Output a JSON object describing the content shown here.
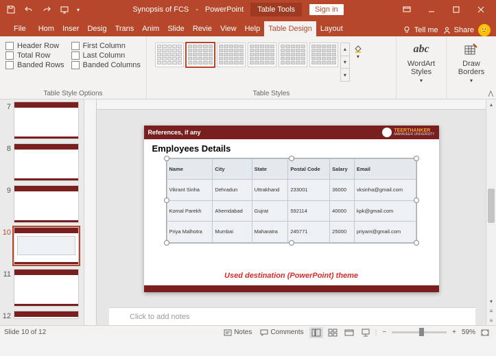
{
  "title": {
    "doc": "Synopsis of FCS",
    "app": "PowerPoint",
    "tool_context": "Table Tools",
    "signin": "Sign in"
  },
  "tabs": {
    "file": "File",
    "home": "Home",
    "insert": "Insert",
    "design": "Design",
    "transitions": "Transitions",
    "animations": "Animations",
    "slideshow": "Slide Show",
    "review": "Review",
    "view": "View",
    "help": "Help",
    "table_design": "Table Design",
    "layout": "Layout",
    "tellme": "Tell me",
    "share": "Share"
  },
  "ribbon": {
    "header_row": "Header Row",
    "first_col": "First Column",
    "total_row": "Total Row",
    "last_col": "Last Column",
    "banded_rows": "Banded Rows",
    "banded_cols": "Banded Columns",
    "group_style_opts": "Table Style Options",
    "group_styles": "Table Styles",
    "wordart": "WordArt Styles",
    "draw_borders": "Draw Borders"
  },
  "thumbs": {
    "7": "7",
    "8": "8",
    "9": "9",
    "10": "10",
    "11": "11",
    "12": "12"
  },
  "slide": {
    "header": "References, if any",
    "university": "TEERTHANKER",
    "university_sub": "MAHAVEER UNIVERSITY",
    "title": "Employees Details",
    "caption": "Used destination (PowerPoint) theme"
  },
  "chart_data": {
    "type": "table",
    "columns": [
      "Name",
      "City",
      "State",
      "Postal Code",
      "Salary",
      "Email"
    ],
    "rows": [
      [
        "Vikrant Sinha",
        "Dehradun",
        "Uttrakhand",
        "233001",
        "36000",
        "vksinha@gmail.com"
      ],
      [
        "Komal Parekh",
        "Ahemdabad",
        "Gujrat",
        "592114",
        "40000",
        "kpk@gmail.com"
      ],
      [
        "Priya Malhotra",
        "Mumbai",
        "Maharatra",
        "245771",
        "25000",
        "priyam@gmail.com"
      ]
    ]
  },
  "notes": {
    "placeholder": "Click to add notes"
  },
  "status": {
    "slide": "Slide 10 of 12",
    "notes": "Notes",
    "comments": "Comments",
    "zoom": "59%"
  }
}
